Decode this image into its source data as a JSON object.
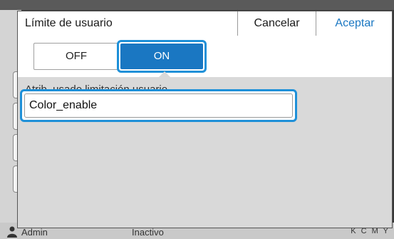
{
  "dialog": {
    "title": "Límite de usuario",
    "cancel_label": "Cancelar",
    "accept_label": "Aceptar",
    "toggle": {
      "off_label": "OFF",
      "on_label": "ON",
      "selected": "ON"
    },
    "field": {
      "label": "Atrib. usado limitación usuario",
      "value": "Color_enable"
    }
  },
  "status_bar": {
    "user": "Admin",
    "state": "Inactivo",
    "ink": "K C M Y"
  },
  "colors": {
    "accent": "#1a77c2",
    "focus_ring": "#1e90d8"
  }
}
